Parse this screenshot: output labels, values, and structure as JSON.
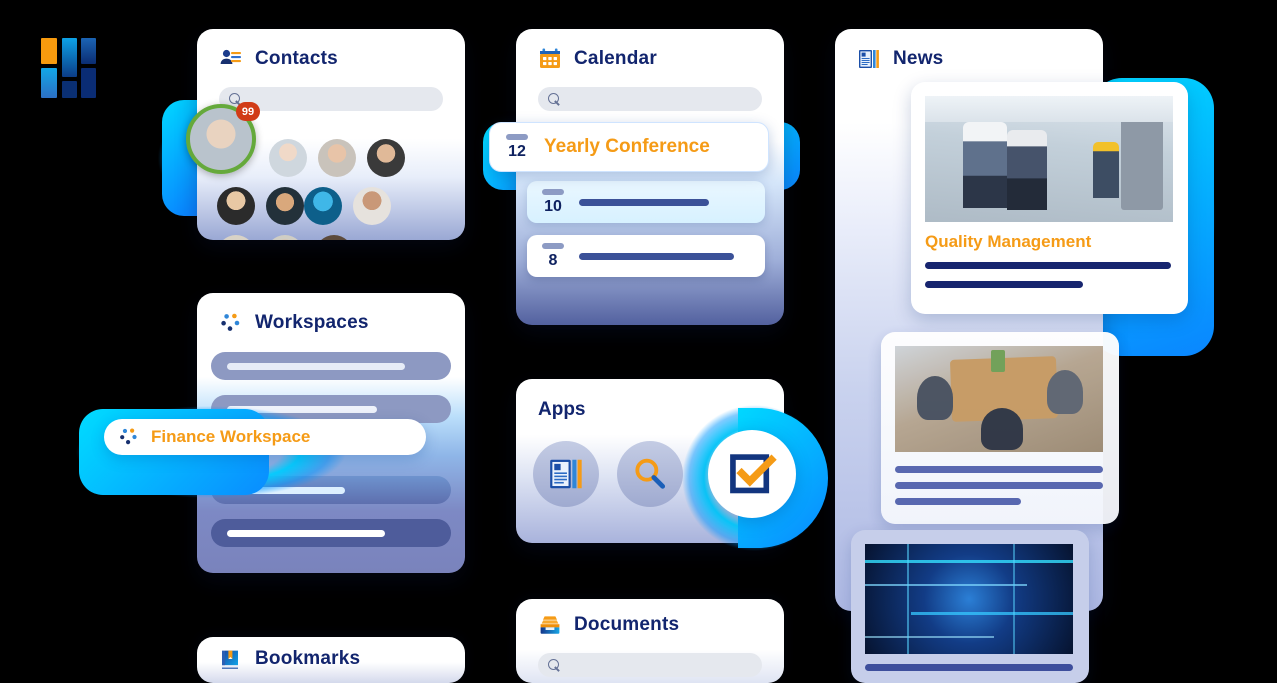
{
  "app": {
    "logo_name": "app-logo",
    "background_color": "#000000",
    "accent_orange": "#F59B16",
    "accent_blue": "#12256E",
    "glow_cyan": "#00D5FF"
  },
  "cards": {
    "contacts": {
      "title": "Contacts",
      "icon": "contacts-icon",
      "search_placeholder": "",
      "search_value": "",
      "highlight_badge": "99",
      "avatar_count": 11
    },
    "calendar": {
      "title": "Calendar",
      "icon": "calendar-icon",
      "search_placeholder": "",
      "search_value": "",
      "events": [
        {
          "day": "12",
          "label": "Yearly Conference",
          "highlighted": true
        },
        {
          "day": "10",
          "label": "",
          "highlighted": false
        },
        {
          "day": "8",
          "label": "",
          "highlighted": false
        }
      ]
    },
    "news": {
      "title": "News",
      "icon": "news-icon",
      "articles": [
        {
          "headline": "Quality Management",
          "image": "factory-engineers-photo"
        },
        {
          "headline": "",
          "image": "office-meeting-photo"
        },
        {
          "headline": "",
          "image": "data-network-photo"
        }
      ]
    },
    "workspaces": {
      "title": "Workspaces",
      "icon": "workspaces-icon",
      "rows": [
        {
          "label": "",
          "highlighted": false
        },
        {
          "label": "",
          "highlighted": false
        },
        {
          "label": "Finance Workspace",
          "highlighted": true
        },
        {
          "label": "",
          "highlighted": false
        },
        {
          "label": "",
          "highlighted": false
        }
      ]
    },
    "apps": {
      "title": "Apps",
      "items": [
        {
          "name": "news-app",
          "icon": "news-icon",
          "highlighted": false
        },
        {
          "name": "search-app",
          "icon": "search-icon",
          "highlighted": false
        },
        {
          "name": "tasks-app",
          "icon": "checkbox-checked-icon",
          "highlighted": true
        }
      ]
    },
    "bookmarks": {
      "title": "Bookmarks",
      "icon": "bookmarks-icon"
    },
    "documents": {
      "title": "Documents",
      "icon": "documents-tray-icon",
      "search_placeholder": "",
      "search_value": ""
    }
  }
}
